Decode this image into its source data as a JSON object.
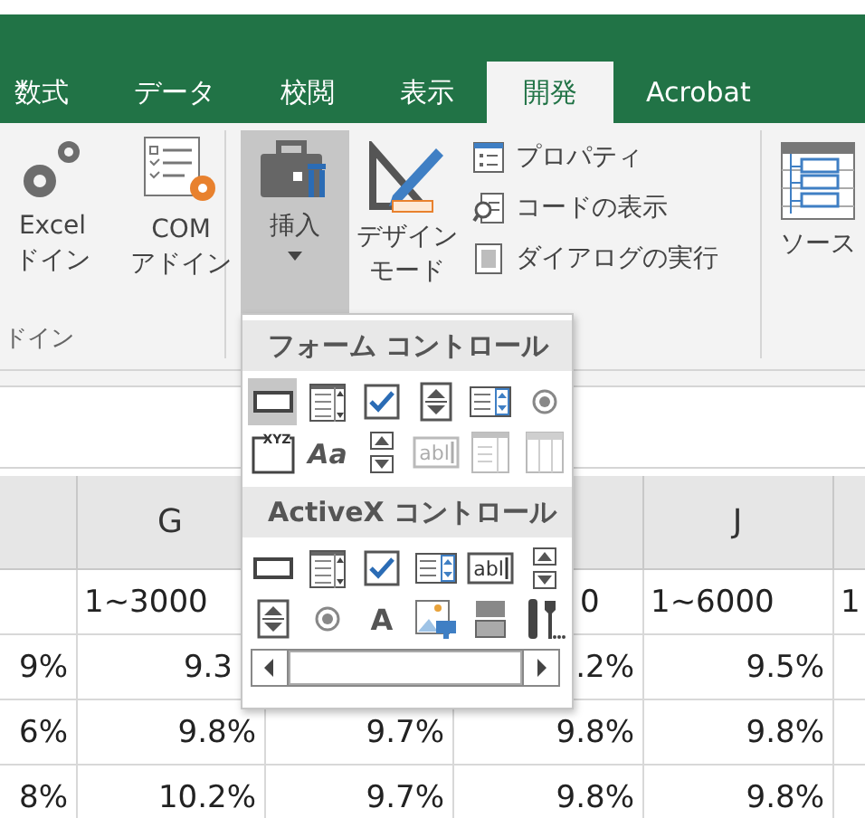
{
  "tabs": [
    {
      "label": "数式",
      "selected": false
    },
    {
      "label": "データ",
      "selected": false
    },
    {
      "label": "校閲",
      "selected": false
    },
    {
      "label": "表示",
      "selected": false
    },
    {
      "label": "開発",
      "selected": true
    },
    {
      "label": "Acrobat",
      "selected": false
    }
  ],
  "ribbon": {
    "addins_group": {
      "label": "ドイン",
      "buttons": [
        {
          "kind": "gears",
          "lines": [
            "Excel",
            "ドイン"
          ]
        },
        {
          "kind": "com",
          "lines": [
            "COM",
            "アドイン"
          ]
        }
      ]
    },
    "controls_group": {
      "insert": {
        "label": "挿入",
        "pressed": true
      },
      "design_mode": {
        "lines": [
          "デザイン",
          "モード"
        ],
        "pressed": false
      },
      "small_buttons": [
        {
          "kind": "properties",
          "label": "プロパティ"
        },
        {
          "kind": "code",
          "label": "コードの表示"
        },
        {
          "kind": "dialog",
          "label": "ダイアログの実行"
        }
      ]
    },
    "xml_group": {
      "source": {
        "label": "ソース"
      }
    }
  },
  "insert_menu": {
    "sections": [
      {
        "title": "フォーム コントロール",
        "controls": [
          {
            "kind": "button",
            "selected": true,
            "disabled": false
          },
          {
            "kind": "combo",
            "selected": false,
            "disabled": false
          },
          {
            "kind": "checkbox",
            "selected": false,
            "disabled": false
          },
          {
            "kind": "spin",
            "selected": false,
            "disabled": false
          },
          {
            "kind": "listbox",
            "selected": false,
            "disabled": false
          },
          {
            "kind": "option",
            "selected": false,
            "disabled": false
          },
          {
            "kind": "groupbox",
            "text": "XYZ",
            "selected": false,
            "disabled": false
          },
          {
            "kind": "label",
            "text": "Aa",
            "selected": false,
            "disabled": false
          },
          {
            "kind": "vscroll",
            "selected": false,
            "disabled": false
          },
          {
            "kind": "textfield",
            "text": "abl",
            "selected": false,
            "disabled": true
          },
          {
            "kind": "combolist",
            "selected": false,
            "disabled": true
          },
          {
            "kind": "combodrop",
            "selected": false,
            "disabled": true
          }
        ]
      },
      {
        "title": "ActiveX コントロール",
        "controls": [
          {
            "kind": "button",
            "selected": false,
            "disabled": false
          },
          {
            "kind": "combo",
            "selected": false,
            "disabled": false
          },
          {
            "kind": "checkbox",
            "selected": false,
            "disabled": false
          },
          {
            "kind": "listbox",
            "selected": false,
            "disabled": false
          },
          {
            "kind": "textfield",
            "text": "abl",
            "selected": false,
            "disabled": false
          },
          {
            "kind": "vscroll",
            "selected": false,
            "disabled": false
          },
          {
            "kind": "spin",
            "selected": false,
            "disabled": false
          },
          {
            "kind": "option",
            "selected": false,
            "disabled": false
          },
          {
            "kind": "label",
            "text": "A",
            "selected": false,
            "disabled": false
          },
          {
            "kind": "image",
            "selected": false,
            "disabled": false
          },
          {
            "kind": "toggle",
            "selected": false,
            "disabled": false
          },
          {
            "kind": "more",
            "selected": false,
            "disabled": false
          },
          {
            "kind": "hscroll",
            "selected": false,
            "disabled": false
          }
        ]
      }
    ]
  },
  "sheet": {
    "columns": [
      null,
      "G",
      null,
      null,
      "J",
      null
    ],
    "rows": [
      [
        null,
        "1~3000",
        null,
        "0",
        "1~6000",
        "1"
      ],
      [
        "9%",
        "9.3",
        null,
        ".2%",
        "9.5%",
        null
      ],
      [
        "6%",
        "9.8%",
        "9.7%",
        "9.8%",
        "9.8%",
        null
      ],
      [
        "8%",
        "10.2%",
        "9.7%",
        "9.8%",
        "9.8%",
        null
      ]
    ]
  }
}
